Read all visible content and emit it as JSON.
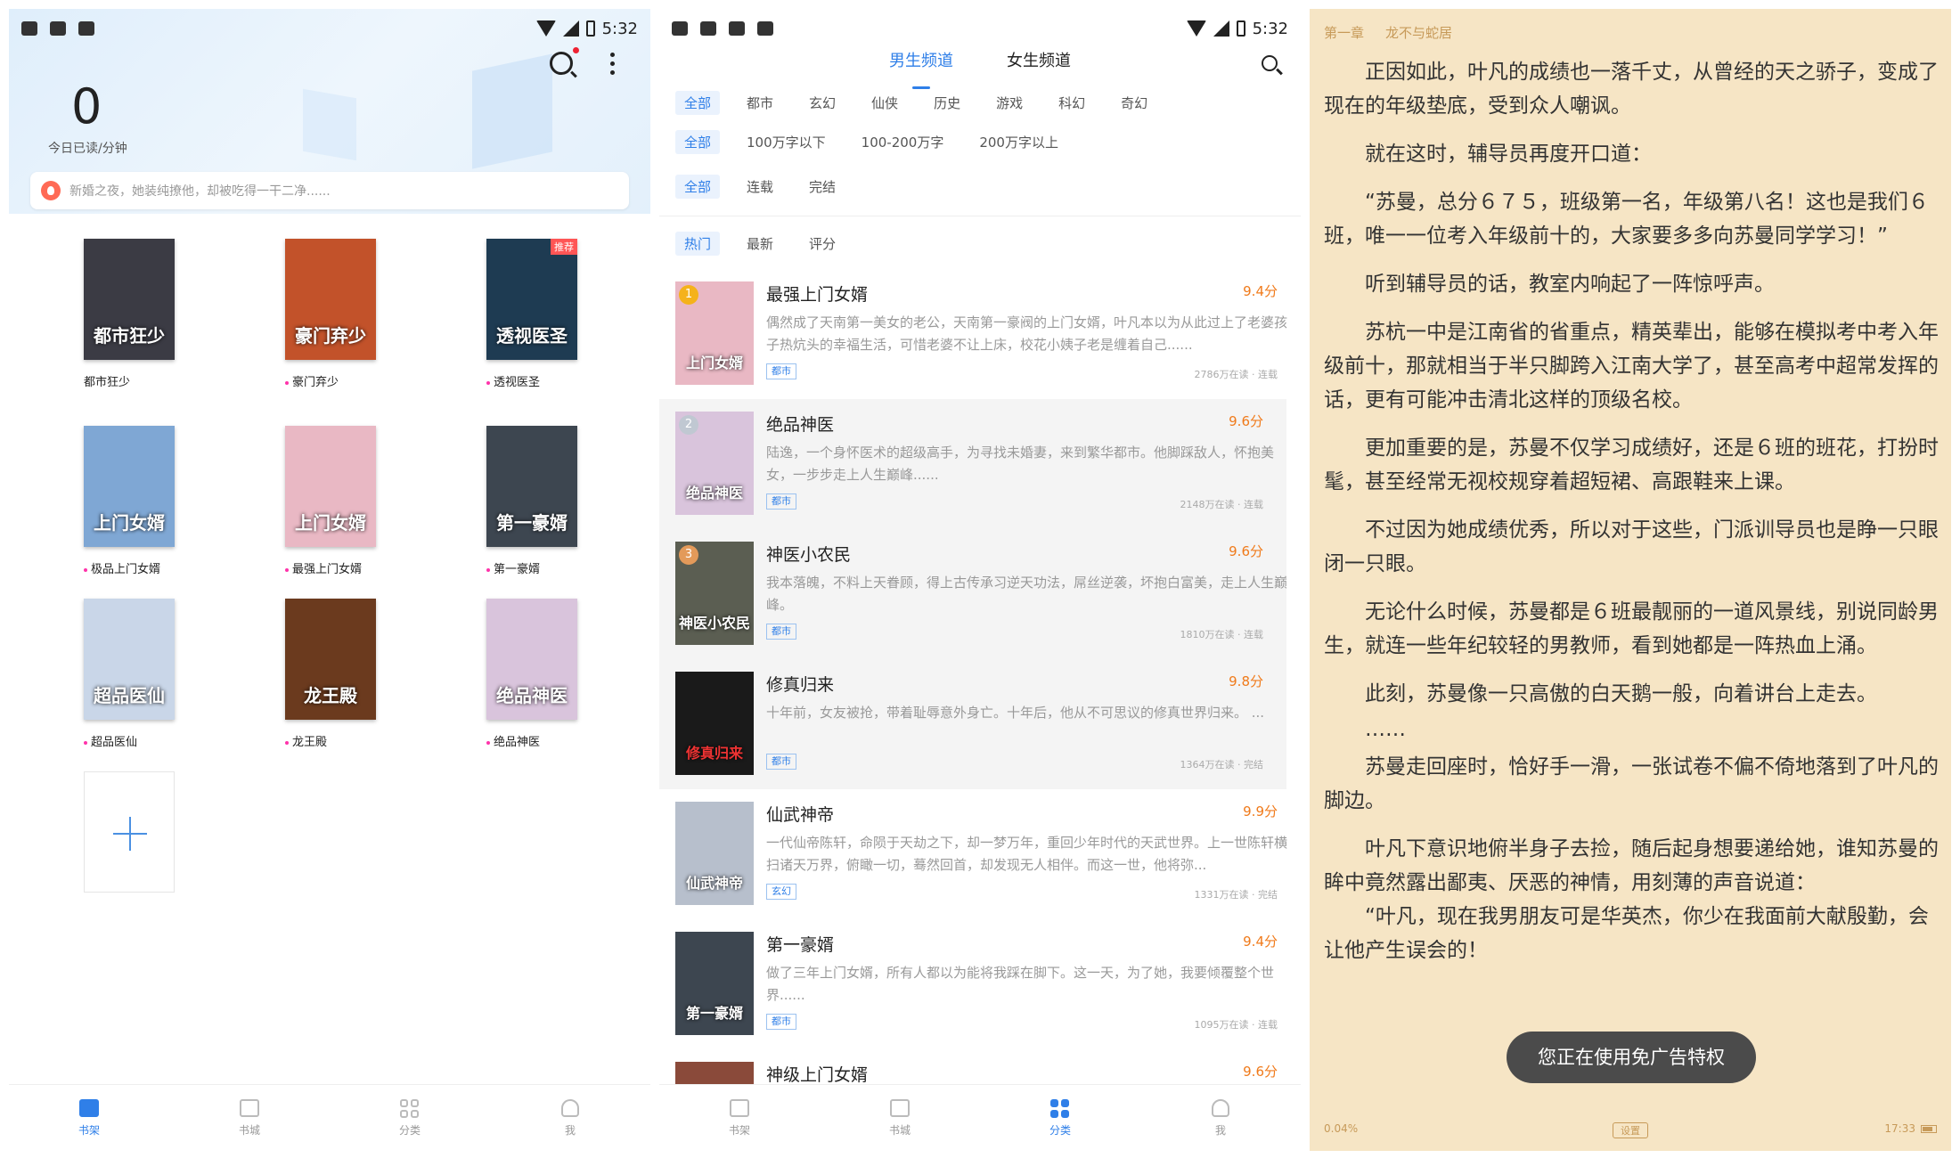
{
  "status": {
    "time": "5:32"
  },
  "shelf": {
    "today_minutes": "0",
    "today_label": "今日已读/分钟",
    "notice": "新婚之夜，她装纯撩他，却被吃得一干二净......",
    "books": [
      {
        "name": "都市狂少",
        "cover": "都市狂少",
        "dot": false,
        "bg": "#3b3b44"
      },
      {
        "name": "豪门弃少",
        "cover": "豪门弃少",
        "dot": true,
        "bg": "#c2522a"
      },
      {
        "name": "透视医圣",
        "cover": "透视医圣",
        "dot": true,
        "bg": "#1e3b52",
        "badge": "推荐"
      },
      {
        "name": "极品上门女婿",
        "cover": "上门女婿",
        "dot": true,
        "bg": "#7fa7d4"
      },
      {
        "name": "最强上门女婿",
        "cover": "上门女婿",
        "dot": true,
        "bg": "#e9b8c4"
      },
      {
        "name": "第一豪婿",
        "cover": "第一豪婿",
        "dot": true,
        "bg": "#3d4650"
      },
      {
        "name": "超品医仙",
        "cover": "超品医仙",
        "dot": true,
        "bg": "#c9d6e8"
      },
      {
        "name": "龙王殿",
        "cover": "龙王殿",
        "dot": true,
        "bg": "#6b3a1e"
      },
      {
        "name": "绝品神医",
        "cover": "绝品神医",
        "dot": true,
        "bg": "#d9c4dc"
      }
    ]
  },
  "tabs": [
    "书架",
    "书城",
    "分类",
    "我"
  ],
  "category": {
    "channels": [
      "男生频道",
      "女生频道"
    ],
    "genres": [
      "全部",
      "都市",
      "玄幻",
      "仙侠",
      "历史",
      "游戏",
      "科幻",
      "奇幻"
    ],
    "lengths": [
      "全部",
      "100万字以下",
      "100-200万字",
      "200万字以上"
    ],
    "states": [
      "全部",
      "连载",
      "完结"
    ],
    "sorts": [
      "热门",
      "最新",
      "评分"
    ],
    "books": [
      {
        "rank": "1",
        "rank_color": "#f5b21b",
        "title": "最强上门女婿",
        "score": "9.4分",
        "desc": "偶然成了天南第一美女的老公，天南第一豪阀的上门女婿，叶凡本以为从此过上了老婆孩子热炕头的幸福生活，可惜老婆不让上床，校花小姨子老是缠着自己......",
        "tag": "都市",
        "meta": "2786万在读 · 连载",
        "cover": "上门女婿",
        "bg": "#e9b8c4"
      },
      {
        "rank": "2",
        "rank_color": "#c0c8d2",
        "title": "绝品神医",
        "score": "9.6分",
        "desc": "陆逸，一个身怀医术的超级高手，为寻找未婚妻，来到繁华都市。他脚踩敌人，怀抱美女，一步步走上人生巅峰......",
        "tag": "都市",
        "meta": "2148万在读 · 连载",
        "cover": "绝品神医",
        "bg": "#d9c4dc"
      },
      {
        "rank": "3",
        "rank_color": "#e39a5a",
        "title": "神医小农民",
        "score": "9.6分",
        "desc": "我本落魄，不料上天眷顾，得上古传承习逆天功法，屌丝逆袭，坏抱白富美，走上人生巅峰。",
        "tag": "都市",
        "meta": "1810万在读 · 连载",
        "cover": "神医小农民",
        "bg": "#5b5e52"
      },
      {
        "rank": "",
        "rank_color": "",
        "title": "修真归来",
        "score": "9.8分",
        "desc": "十年前，女友被抢，带着耻辱意外身亡。十年后，他从不可思议的修真世界归来。 ...",
        "tag": "都市",
        "meta": "1364万在读 · 完结",
        "cover": "修真归来",
        "bg": "#1a1a1a"
      },
      {
        "rank": "",
        "rank_color": "",
        "title": "仙武神帝",
        "score": "9.9分",
        "desc": "一代仙帝陈轩，命陨于天劫之下，却一梦万年，重回少年时代的天武世界。上一世陈轩横扫诸天万界，俯瞰一切，蓦然回首，却发现无人相伴。而这一世，他将弥...",
        "tag": "玄幻",
        "meta": "1331万在读 · 完结",
        "cover": "仙武神帝",
        "bg": "#b7bfcc"
      },
      {
        "rank": "",
        "rank_color": "",
        "title": "第一豪婿",
        "score": "9.4分",
        "desc": "做了三年上门女婿，所有人都以为能将我踩在脚下。这一天，为了她，我要倾覆整个世界......",
        "tag": "都市",
        "meta": "1095万在读 · 连载",
        "cover": "第一豪婿",
        "bg": "#3d4650"
      },
      {
        "rank": "",
        "rank_color": "",
        "title": "神级上门女婿",
        "score": "9.6分",
        "desc": "",
        "tag": "",
        "meta": "",
        "cover": "",
        "bg": "#8a4a3a"
      }
    ]
  },
  "reader": {
    "chapter": "第一章",
    "chapter_title": "龙不与蛇居",
    "paragraphs": [
      "正因如此，叶凡的成绩也一落千丈，从曾经的天之骄子，变成了现在的年级垫底，受到众人嘲讽。",
      "就在这时，辅导员再度开口道：",
      "“苏曼，总分６７５，班级第一名，年级第八名！这也是我们６班，唯一一位考入年级前十的，大家要多多向苏曼同学学习！”",
      "听到辅导员的话，教室内响起了一阵惊呼声。",
      "苏杭一中是江南省的省重点，精英辈出，能够在模拟考中考入年级前十，那就相当于半只脚跨入江南大学了，甚至高考中超常发挥的话，更有可能冲击清北这样的顶级名校。",
      "更加重要的是，苏曼不仅学习成绩好，还是６班的班花，打扮时髦，甚至经常无视校规穿着超短裙、高跟鞋来上课。",
      "不过因为她成绩优秀，所以对于这些，门派训导员也是睁一只眼闭一只眼。",
      "无论什么时候，苏曼都是６班最靓丽的一道风景线，别说同龄男生，就连一些年纪较轻的男教师，看到她都是一阵热血上涌。",
      "此刻，苏曼像一只高傲的白天鹅一般，向着讲台上走去。",
      "……",
      "苏曼走回座时，恰好手一滑，一张试卷不偏不倚地落到了叶凡的脚边。",
      "叶凡下意识地俯半身子去捡，随后起身想要递给她，谁知苏曼的眸中竟然露出鄙夷、厌恶的神情，用刻薄的声音说道：",
      "“叶凡，现在我男朋友可是华英杰，你少在我面前大献殷勤，会让他产生误会的！"
    ],
    "toast": "您正在使用免广告特权",
    "progress": "0.04%",
    "settings": "设置",
    "clock": "17:33"
  }
}
